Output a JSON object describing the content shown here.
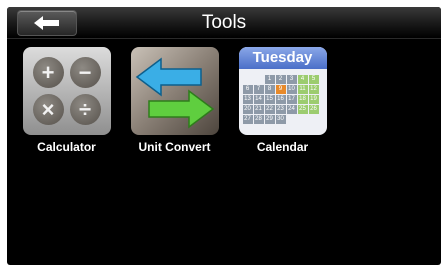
{
  "header": {
    "title": "Tools"
  },
  "apps": [
    {
      "label": "Calculator"
    },
    {
      "label": "Unit Convert"
    },
    {
      "label": "Calendar"
    }
  ],
  "calendar_icon": {
    "day": "Tuesday",
    "days": [
      "",
      "",
      "1",
      "2",
      "3",
      "4",
      "5",
      "6",
      "7",
      "8",
      "9",
      "10",
      "11",
      "12",
      "13",
      "14",
      "15",
      "16",
      "17",
      "18",
      "19",
      "20",
      "21",
      "22",
      "23",
      "24",
      "25",
      "26",
      "27",
      "28",
      "29",
      "30",
      "",
      "",
      ""
    ]
  },
  "colors": {
    "background": "#000000",
    "calendar_header": "#5b7fd3",
    "arrow_blue": "#3aaee6",
    "arrow_green": "#5fce3f"
  }
}
